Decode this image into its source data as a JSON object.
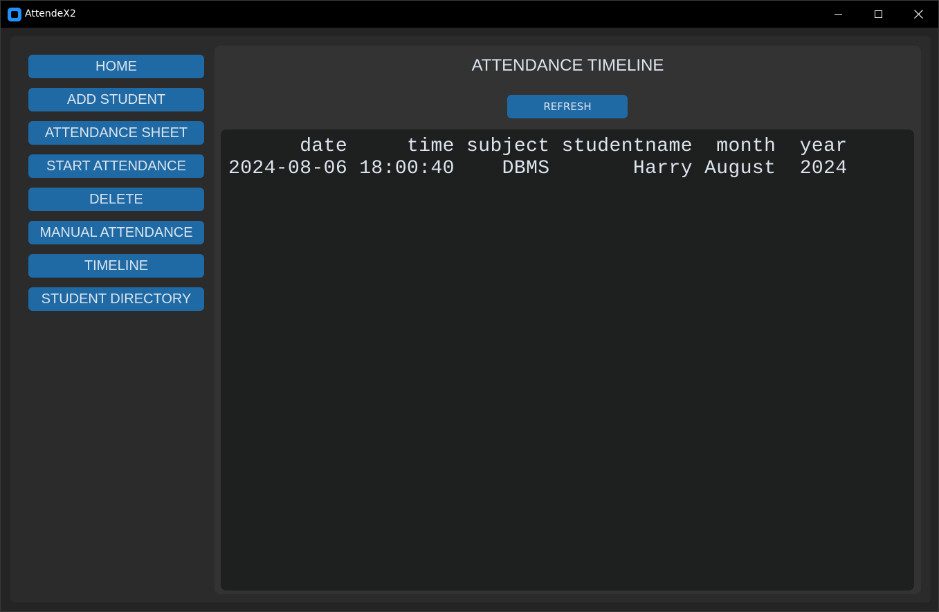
{
  "window": {
    "title": "AttendeX2",
    "controls": {
      "minimize": "minimize-icon",
      "maximize": "maximize-icon",
      "close": "close-icon"
    }
  },
  "sidebar": {
    "items": [
      {
        "label": "HOME"
      },
      {
        "label": "ADD STUDENT"
      },
      {
        "label": "ATTENDANCE SHEET"
      },
      {
        "label": "START ATTENDANCE"
      },
      {
        "label": "DELETE"
      },
      {
        "label": "MANUAL ATTENDANCE"
      },
      {
        "label": "TIMELINE"
      },
      {
        "label": "STUDENT DIRECTORY"
      }
    ]
  },
  "main": {
    "title": "ATTENDANCE TIMELINE",
    "refresh_label": "REFRESH",
    "table": {
      "header_line": "      date     time subject studentname  month  year",
      "rows": [
        "2024-08-06 18:00:40    DBMS       Harry August  2024"
      ]
    }
  },
  "colors": {
    "accent": "#1f6aa5",
    "window_bg": "#242424",
    "panel_bg": "#2b2b2b",
    "main_bg": "#333333",
    "textbox_bg": "#1e1f1f",
    "text": "#dce4ee"
  }
}
